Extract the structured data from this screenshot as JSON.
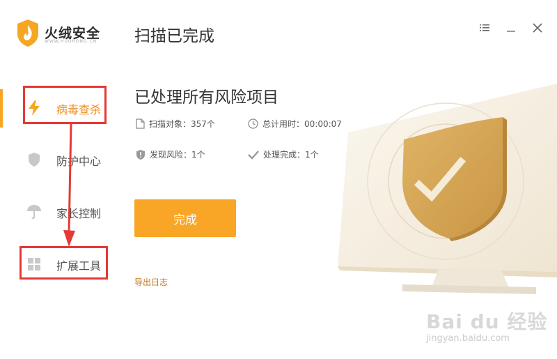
{
  "app": {
    "logo_text": "火绒安全",
    "logo_sub": "WWW.HUORONG.CN",
    "window_title": "扫描已完成"
  },
  "window_controls": [
    "menu-icon",
    "minimize-icon",
    "close-icon"
  ],
  "sidebar": {
    "items": [
      {
        "label": "病毒查杀",
        "icon": "lightning-icon",
        "active": true
      },
      {
        "label": "防护中心",
        "icon": "shield-icon",
        "active": false
      },
      {
        "label": "家长控制",
        "icon": "umbrella-icon",
        "active": false
      },
      {
        "label": "扩展工具",
        "icon": "grid-icon",
        "active": false
      }
    ]
  },
  "main": {
    "headline": "已处理所有风险项目",
    "stats": {
      "scan_objects": "扫描对象：357个",
      "total_time": "总计用时：00:00:07",
      "risks_found": "发现风险：1个",
      "handled": "处理完成：1个"
    },
    "done_button": "完成",
    "export_log": "导出日志"
  },
  "watermark": {
    "main": "Bai du 经验",
    "sub": "jingyan.baidu.com"
  },
  "colors": {
    "accent": "#f9a526",
    "annotation_red": "#e53935",
    "active_text": "#f08c1a"
  }
}
